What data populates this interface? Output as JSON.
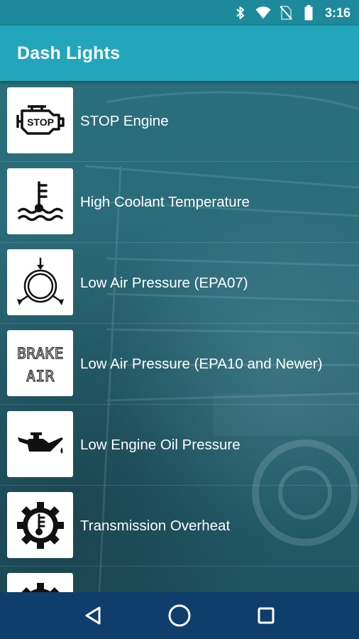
{
  "status_bar": {
    "time": "3:16",
    "icons": [
      "bluetooth-icon",
      "wifi-icon",
      "no-sim-icon",
      "battery-icon"
    ]
  },
  "app_bar": {
    "title": "Dash Lights"
  },
  "list": {
    "items": [
      {
        "label": "STOP Engine",
        "icon": "stop-engine-icon",
        "icon_text": "STOP"
      },
      {
        "label": "High Coolant Temperature",
        "icon": "coolant-temperature-icon"
      },
      {
        "label": "Low Air Pressure (EPA07)",
        "icon": "air-pressure-icon"
      },
      {
        "label": "Low Air Pressure (EPA10 and Newer)",
        "icon": "brake-air-icon",
        "icon_text_1": "BRAKE",
        "icon_text_2": "AIR"
      },
      {
        "label": "Low Engine Oil Pressure",
        "icon": "oil-can-icon"
      },
      {
        "label": "Transmission Overheat",
        "icon": "transmission-temperature-icon"
      },
      {
        "label": "",
        "icon": "gear-icon"
      }
    ]
  },
  "nav_bar": {
    "buttons": [
      "back-icon",
      "home-icon",
      "recents-icon"
    ]
  },
  "colors": {
    "status_bar": "#1d8a9c",
    "app_bar": "#23a6bb",
    "nav_bar": "#0f3d6c",
    "text": "#ffffff"
  }
}
